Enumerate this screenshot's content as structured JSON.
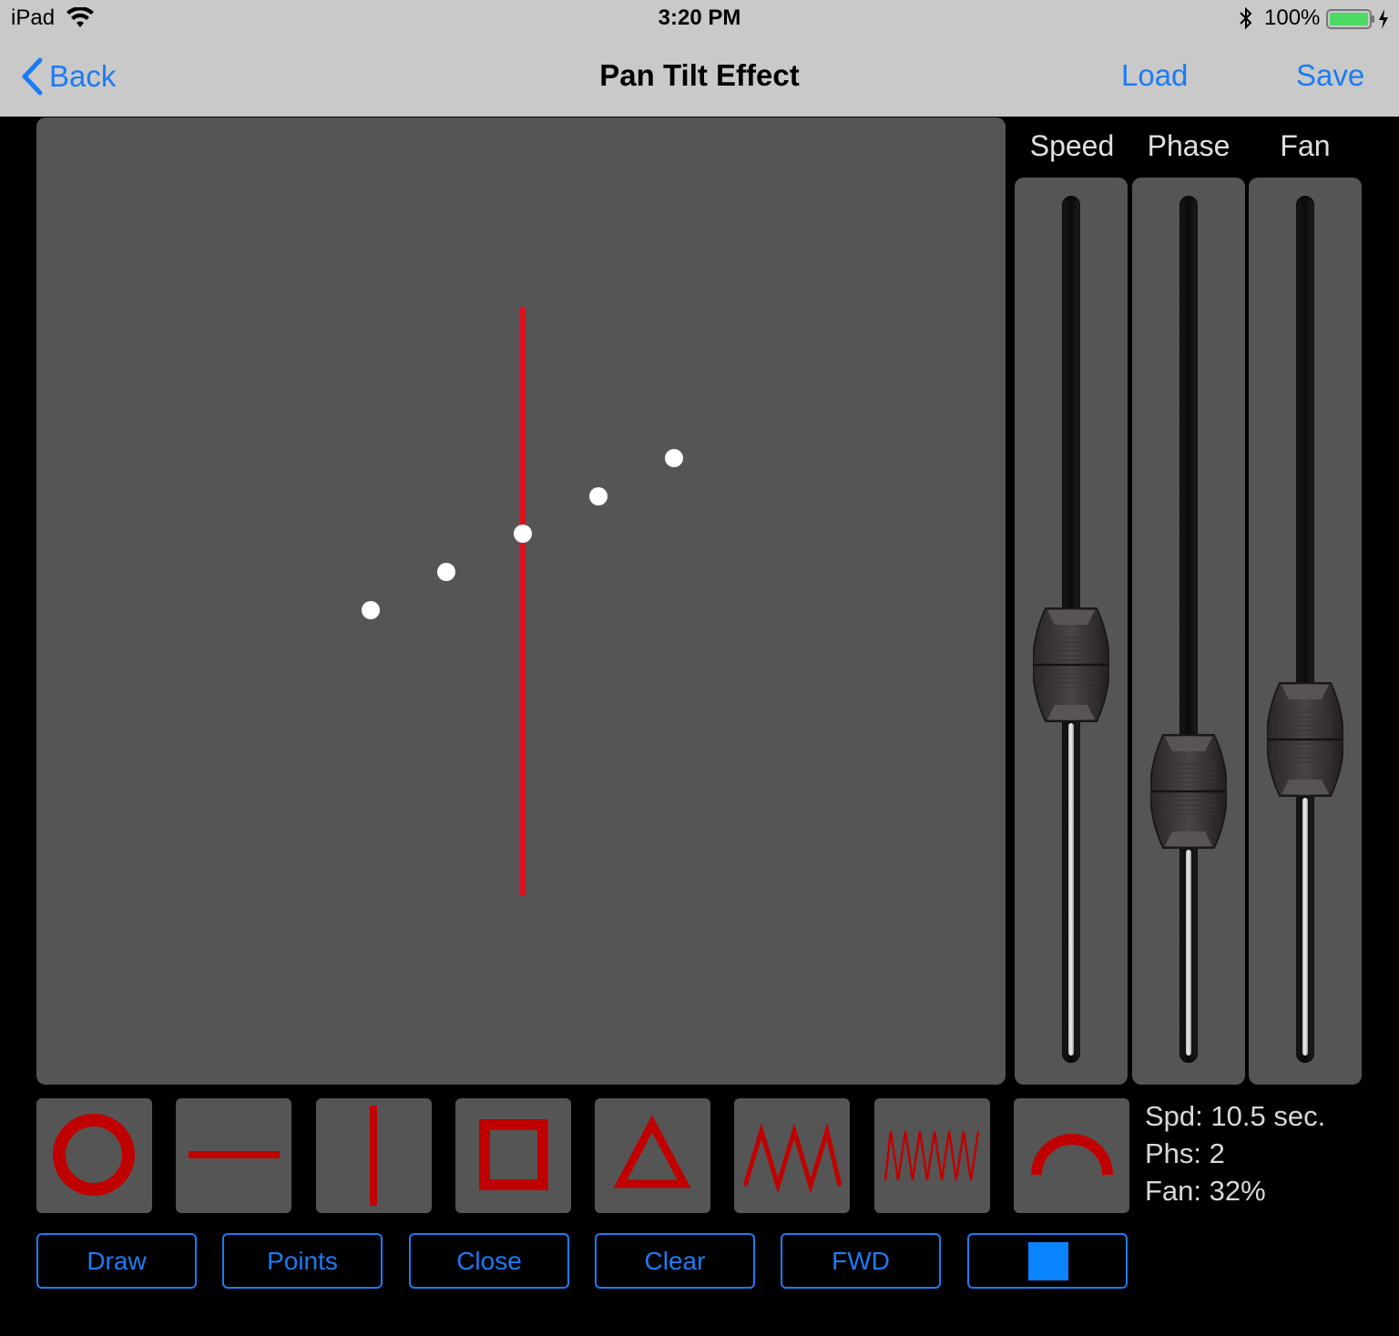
{
  "status_bar": {
    "device": "iPad",
    "time": "3:20 PM",
    "battery": "100%"
  },
  "nav": {
    "back_label": "Back",
    "title": "Pan Tilt Effect",
    "load_label": "Load",
    "save_label": "Save"
  },
  "sliders": [
    {
      "label": "Speed",
      "level": 0.42
    },
    {
      "label": "Phase",
      "level": 0.25
    },
    {
      "label": "Fan",
      "level": 0.32
    }
  ],
  "shapes": [
    "circle",
    "horizontal-line",
    "vertical-line",
    "square",
    "triangle",
    "zigzag",
    "dense-zigzag",
    "arc"
  ],
  "info": {
    "speed": "Spd: 10.5 sec.",
    "phase": "Phs: 2",
    "fan": "Fan: 32%"
  },
  "controls": {
    "draw": "Draw",
    "points": "Points",
    "close": "Close",
    "clear": "Clear",
    "direction": "FWD",
    "stop_icon": "stop-square-icon"
  },
  "colors": {
    "accent": "#1a7cf5",
    "path": "#e0101a",
    "shape": "#c00000",
    "battery": "#4cd964",
    "panel": "#555555"
  }
}
